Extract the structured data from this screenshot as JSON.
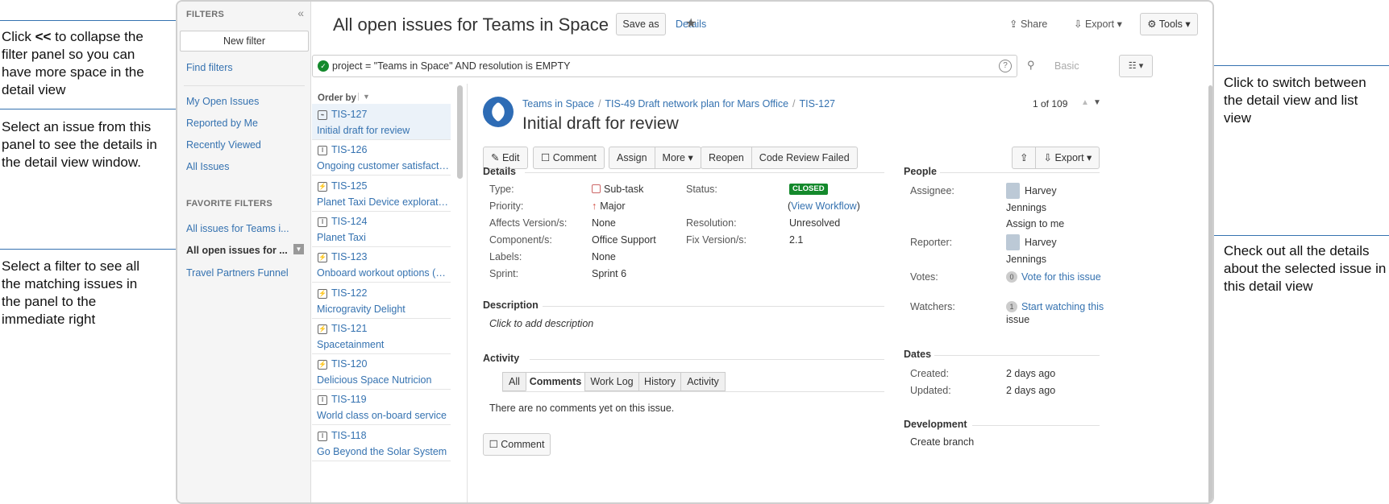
{
  "callouts": {
    "collapse_pre": "Click ",
    "collapse_bold": "<<",
    "collapse_post": " to collapse the filter panel so you can have more space in the detail view",
    "select_issue": "Select an issue from this panel to see the details in the detail view window.",
    "select_filter": "Select a filter to see all the matching issues in the panel to the immediate right",
    "switch_view": "Click to switch between the detail view and list view",
    "check_details": "Check out all the details about the selected issue in this detail view"
  },
  "filters": {
    "heading": "FILTERS",
    "collapse_glyph": "«",
    "new_filter": "New filter",
    "find_filters": "Find filters",
    "my_open": "My Open Issues",
    "reported": "Reported by Me",
    "recent": "Recently Viewed",
    "all": "All Issues",
    "favorites_heading": "FAVORITE FILTERS",
    "fav1": "All issues for Teams i...",
    "fav2": "All open issues for ...",
    "fav3": "Travel Partners Funnel"
  },
  "header": {
    "title": "All open issues for Teams in Space",
    "save_as": "Save as",
    "details": "Details",
    "share": "Share",
    "export": "Export",
    "tools": "Tools"
  },
  "search": {
    "query": "project = \"Teams in Space\" AND resolution is EMPTY",
    "help": "?",
    "basic": "Basic"
  },
  "list": {
    "order_by": "Order by",
    "items": [
      {
        "key": "TIS-127",
        "summary": "Initial draft for review"
      },
      {
        "key": "TIS-126",
        "summary": "Ongoing customer satisfaction"
      },
      {
        "key": "TIS-125",
        "summary": "Planet Taxi Device exploration..."
      },
      {
        "key": "TIS-124",
        "summary": "Planet Taxi"
      },
      {
        "key": "TIS-123",
        "summary": "Onboard workout options (OW..."
      },
      {
        "key": "TIS-122",
        "summary": "Microgravity Delight"
      },
      {
        "key": "TIS-121",
        "summary": "Spacetainment"
      },
      {
        "key": "TIS-120",
        "summary": "Delicious Space Nutricion"
      },
      {
        "key": "TIS-119",
        "summary": "World class on-board service"
      },
      {
        "key": "TIS-118",
        "summary": "Go Beyond the Solar System"
      }
    ]
  },
  "issue": {
    "crumb_project": "Teams in Space",
    "crumb_parent": "TIS-49 Draft network plan for Mars Office",
    "crumb_key": "TIS-127",
    "title": "Initial draft for review",
    "counter": "1 of 109",
    "toolbar": {
      "edit": "Edit",
      "comment": "Comment",
      "assign": "Assign",
      "more": "More",
      "reopen": "Reopen",
      "code_review": "Code Review Failed",
      "export": "Export"
    },
    "details_heading": "Details",
    "type_label": "Type:",
    "type_value": "Sub-task",
    "priority_label": "Priority:",
    "priority_value": "Major",
    "affects_label": "Affects Version/s:",
    "affects_value": "None",
    "component_label": "Component/s:",
    "component_value": "Office Support",
    "labels_label": "Labels:",
    "labels_value": "None",
    "sprint_label": "Sprint:",
    "sprint_value": "Sprint 6",
    "status_label": "Status:",
    "status_value": "CLOSED",
    "view_workflow": "View Workflow",
    "resolution_label": "Resolution:",
    "resolution_value": "Unresolved",
    "fix_label": "Fix Version/s:",
    "fix_value": "2.1",
    "description_heading": "Description",
    "description_placeholder": "Click to add description",
    "activity_heading": "Activity",
    "tabs": [
      "All",
      "Comments",
      "Work Log",
      "History",
      "Activity"
    ],
    "no_comments": "There are no comments yet on this issue.",
    "comment_button": "Comment",
    "people_heading": "People",
    "assignee_label": "Assignee:",
    "assignee_first": "Harvey",
    "assignee_last": "Jennings",
    "assign_to_me": "Assign to me",
    "reporter_label": "Reporter:",
    "reporter_first": "Harvey",
    "reporter_last": "Jennings",
    "votes_label": "Votes:",
    "votes_count": "0",
    "vote_link": "Vote for this issue",
    "watchers_label": "Watchers:",
    "watchers_count": "1",
    "watch_link1": "Start watching this",
    "watch_link2": "issue",
    "dates_heading": "Dates",
    "created_label": "Created:",
    "created_value": "2 days ago",
    "updated_label": "Updated:",
    "updated_value": "2 days ago",
    "development_heading": "Development",
    "create_branch": "Create branch"
  },
  "colors": {
    "accent": "#3572b0",
    "success": "#14892c",
    "priority": "#d04437"
  }
}
